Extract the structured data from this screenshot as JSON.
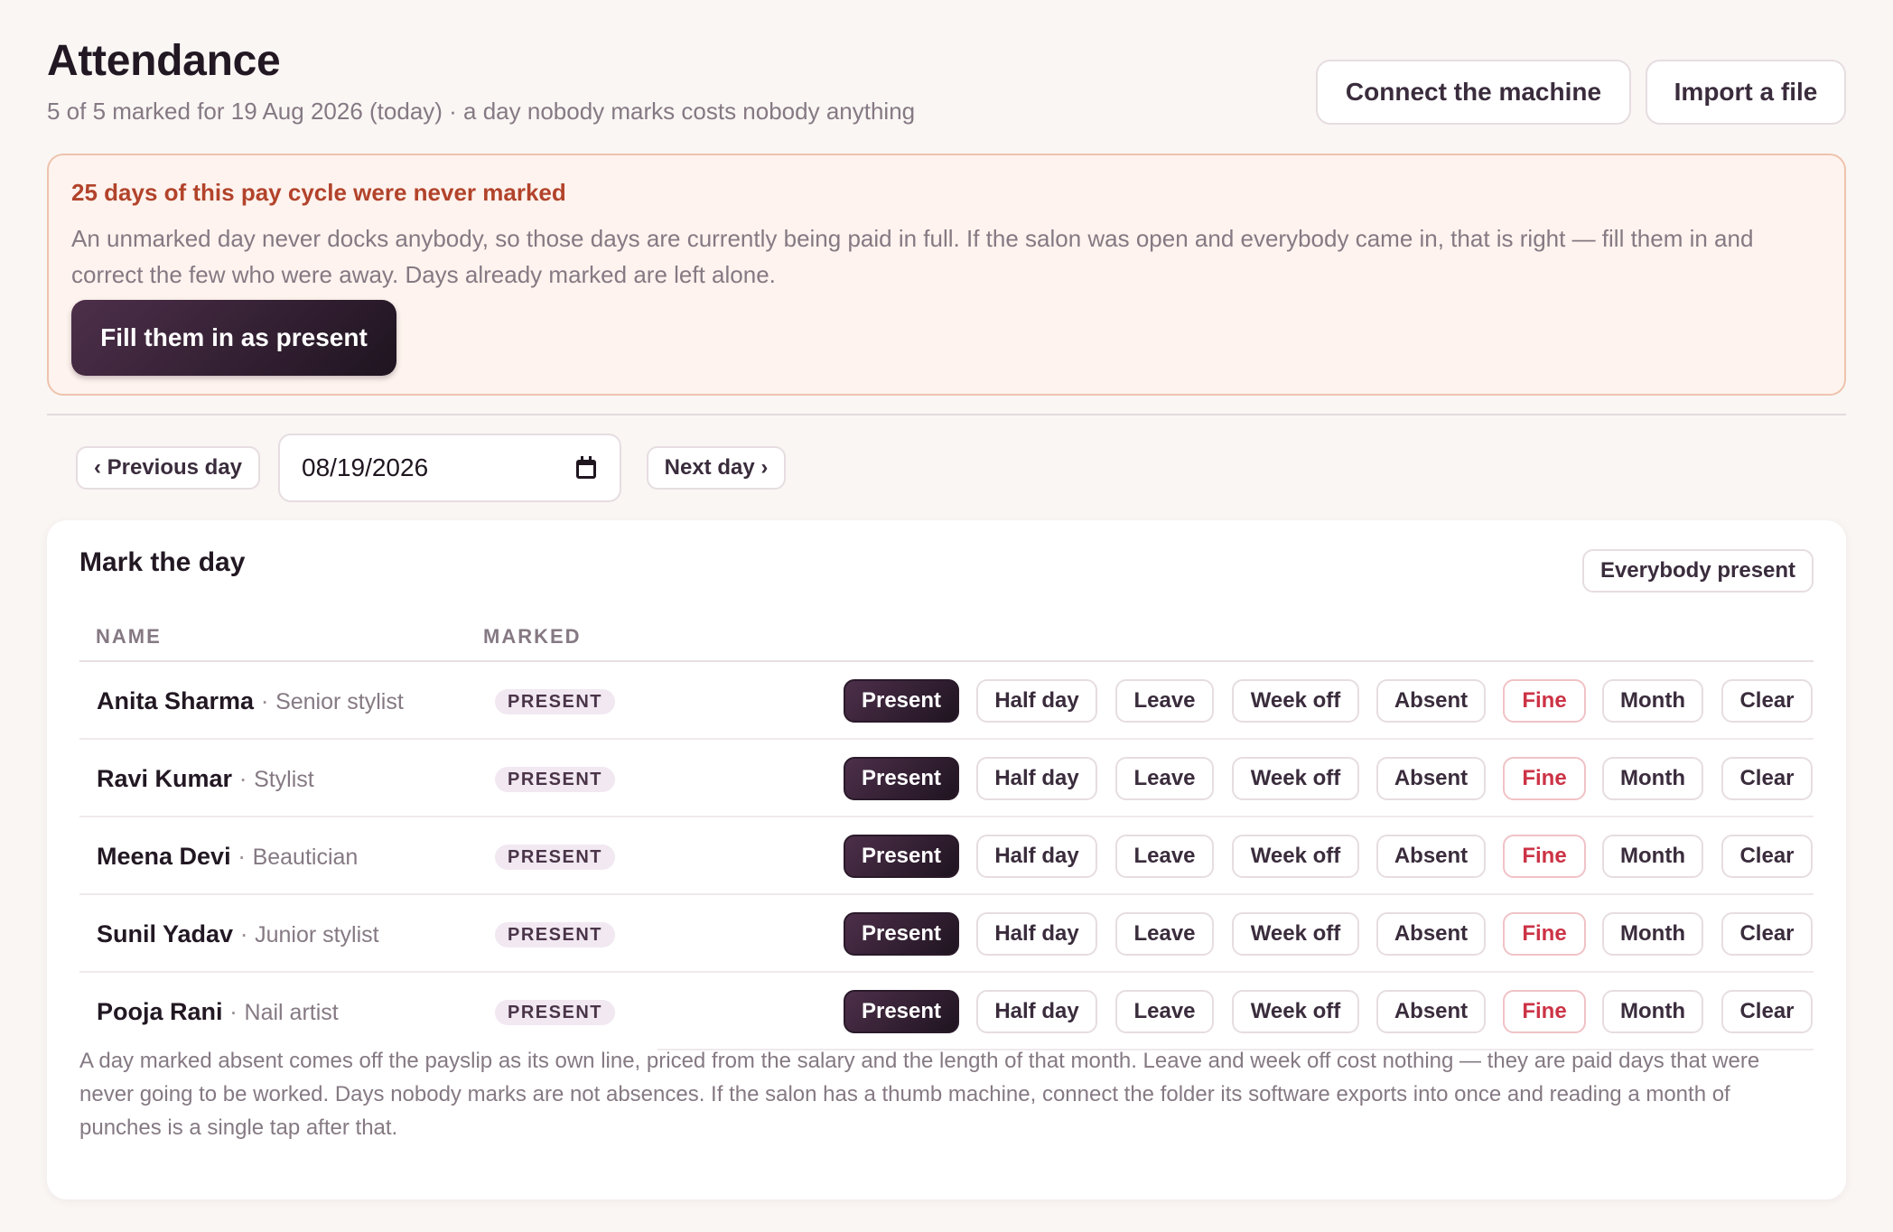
{
  "header": {
    "title": "Attendance",
    "subtitle": "5 of 5 marked for 19 Aug 2026 (today) · a day nobody marks costs nobody anything",
    "connect_label": "Connect the machine",
    "import_label": "Import a file"
  },
  "warning": {
    "title": "25 days of this pay cycle were never marked",
    "body": "An unmarked day never docks anybody, so those days are currently being paid in full. If the salon was open and everybody came in, that is right — fill them in and correct the few who were away. Days already marked are left alone.",
    "action_label": "Fill them in as present"
  },
  "nav": {
    "prev_label": "‹ Previous day",
    "date_value": "08/19/2026",
    "next_label": "Next day ›"
  },
  "card": {
    "title": "Mark the day",
    "everybody_label": "Everybody present",
    "col_name": "NAME",
    "col_marked": "MARKED",
    "options": [
      "Present",
      "Half day",
      "Leave",
      "Week off",
      "Absent",
      "Fine",
      "Month",
      "Clear"
    ],
    "rows": [
      {
        "name": "Anita Sharma",
        "role": "Senior stylist",
        "status": "PRESENT",
        "selected": "Present"
      },
      {
        "name": "Ravi Kumar",
        "role": "Stylist",
        "status": "PRESENT",
        "selected": "Present"
      },
      {
        "name": "Meena Devi",
        "role": "Beautician",
        "status": "PRESENT",
        "selected": "Present"
      },
      {
        "name": "Sunil Yadav",
        "role": "Junior stylist",
        "status": "PRESENT",
        "selected": "Present"
      },
      {
        "name": "Pooja Rani",
        "role": "Nail artist",
        "status": "PRESENT",
        "selected": "Present"
      }
    ],
    "footnote": "A day marked absent comes off the payslip as its own line, priced from the salary and the length of that month. Leave and week off cost nothing — they are paid days that were never going to be worked. Days nobody marks are not absences. If the salon has a thumb machine, connect the folder its software exports into once and reading a month of punches is a single tap after that."
  },
  "colors": {
    "accent_dark": "#2a1a2a",
    "warning_text": "#b2432b",
    "warning_bg": "#fef3ee",
    "fine_text": "#cc3346"
  }
}
